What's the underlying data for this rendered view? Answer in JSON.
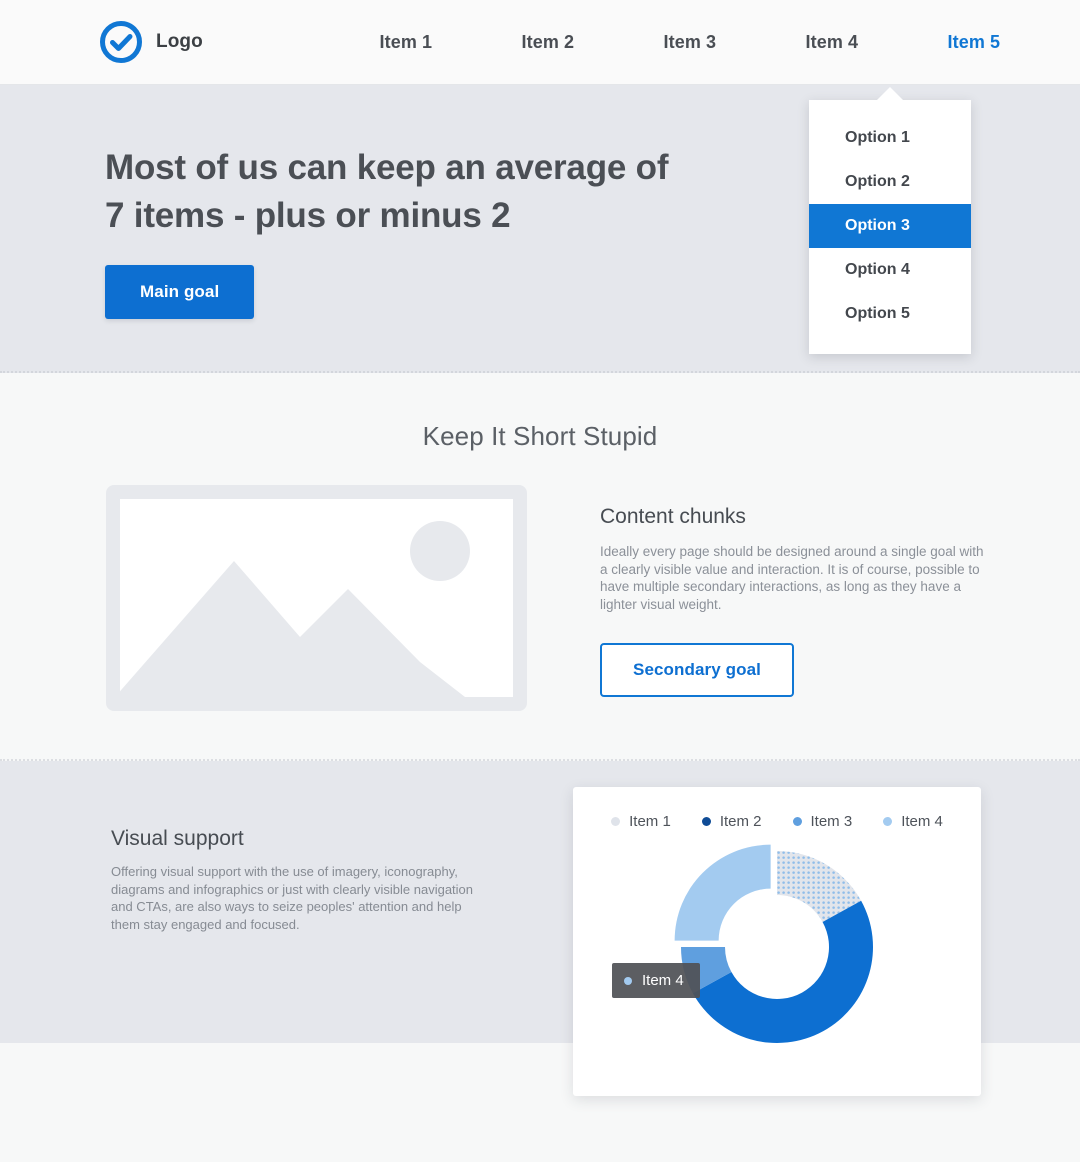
{
  "colors": {
    "accent": "#1077d4",
    "accent_button": "#0d6fd1",
    "hero_bg": "#e5e7ec",
    "light_bg": "#f7f8f8",
    "nav_bg": "#fafafa",
    "text_dark": "#4b4f55",
    "text_muted": "#8b9098",
    "donut_item1": "#dfe3ea",
    "donut_item2": "#0d6fd1",
    "donut_item3": "#5f9fdf",
    "donut_item4": "#a3cbf0",
    "legend_item2_dot": "#0f4c96",
    "tooltip_bg": "#505256"
  },
  "navbar": {
    "logo_icon": "check-circle-icon",
    "logo_label": "Logo",
    "items": [
      {
        "label": "Item 1",
        "active": false
      },
      {
        "label": "Item 2",
        "active": false
      },
      {
        "label": "Item 3",
        "active": false
      },
      {
        "label": "Item 4",
        "active": false
      },
      {
        "label": "Item 5",
        "active": true
      }
    ]
  },
  "dropdown": {
    "open": true,
    "anchor": "Item 5",
    "selected": "Option 3",
    "options": [
      {
        "label": "Option 1",
        "selected": false
      },
      {
        "label": "Option 2",
        "selected": false
      },
      {
        "label": "Option 3",
        "selected": true
      },
      {
        "label": "Option 4",
        "selected": false
      },
      {
        "label": "Option 5",
        "selected": false
      }
    ]
  },
  "hero": {
    "title": "Most of us can keep an average of 7 items - plus or minus 2",
    "cta_label": "Main goal"
  },
  "section_kiss": {
    "heading": "Keep It Short Stupid",
    "image_placeholder_icon": "image-placeholder-icon",
    "content_title": "Content chunks",
    "content_body": "Ideally every page should be designed around a single goal with a clearly visible value and interaction. It is of course, possible to have multiple secondary interactions, as long as they have a lighter visual weight.",
    "cta_label": "Secondary goal"
  },
  "section_visual": {
    "title": "Visual support",
    "body": "Offering visual support with the use of imagery, iconography, diagrams and infographics or just with clearly visible navigation and CTAs, are also ways to seize peoples' attention and help them stay engaged and focused."
  },
  "chart_data": {
    "type": "pie",
    "variant": "donut",
    "title": "",
    "legend_position": "top",
    "categories": [
      "Item 1",
      "Item 2",
      "Item 3",
      "Item 4"
    ],
    "values": [
      17,
      50,
      8,
      25
    ],
    "colors": [
      "#dfe3ea",
      "#0d6fd1",
      "#5f9fdf",
      "#a3cbf0"
    ],
    "legend_dot_colors": [
      "#dfe3ea",
      "#0f4c96",
      "#5f9fdf",
      "#a3cbf0"
    ],
    "highlighted_slice": "Item 1",
    "exploded_slice": "Item 4",
    "tooltip": {
      "visible": true,
      "label": "Item 4",
      "dot_color": "#a3cbf0"
    }
  }
}
